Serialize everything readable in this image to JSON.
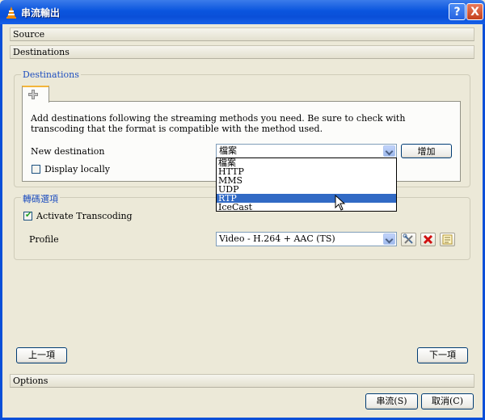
{
  "window": {
    "title": "串流輸出",
    "help_label": "?",
    "close_label": "X"
  },
  "sections": {
    "source": "Source",
    "destinations": "Destinations",
    "options": "Options"
  },
  "destinations_group": {
    "title": "Destinations",
    "description": "Add destinations following the streaming methods you need. Be sure to check with transcoding that the format is compatible with the method used.",
    "new_destination_label": "New destination",
    "new_destination_value": "檔案",
    "add_button": "增加",
    "display_locally_label": "Display locally",
    "display_locally_checked": false,
    "options": [
      "檔案",
      "HTTP",
      "MMS",
      "UDP",
      "RTP",
      "IceCast"
    ],
    "highlighted_option": "RTP"
  },
  "transcoding_group": {
    "title": "轉碼選項",
    "activate_label": "Activate Transcoding",
    "activate_checked": true,
    "profile_label": "Profile",
    "profile_value": "Video - H.264 + AAC (TS)",
    "edit_icon": "wrench-icon",
    "delete_icon": "red-x-icon",
    "new_icon": "new-profile-icon"
  },
  "navigation": {
    "prev_button": "上一項",
    "next_button": "下一項"
  },
  "footer": {
    "stream_button": "串流(S)",
    "cancel_button": "取消(C)"
  },
  "colors": {
    "titlebar": "#0A55DE",
    "group_title": "#1F4FBF",
    "selection": "#316AC5",
    "tab_accent": "#F3B53A"
  }
}
